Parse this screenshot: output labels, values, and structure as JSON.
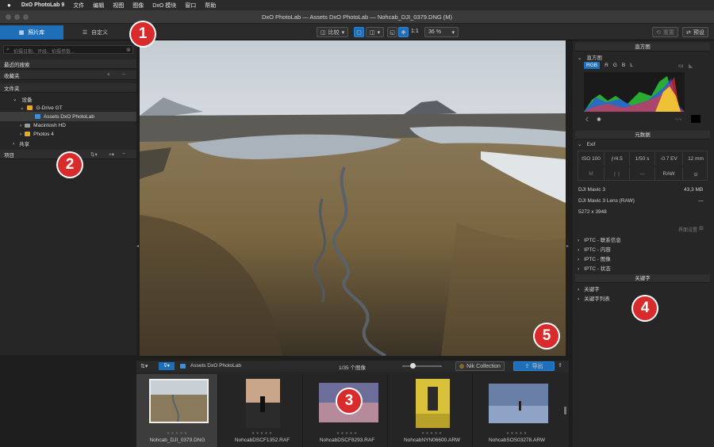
{
  "menubar": {
    "app": "DxO PhotoLab 9",
    "items": [
      "文件",
      "编辑",
      "视图",
      "图像",
      "DxO 模块",
      "窗口",
      "帮助"
    ]
  },
  "window": {
    "title": "DxO PhotoLab — Assets DxO PhotoLab — Nohcab_DJI_0379.DNG (M)"
  },
  "tabs": {
    "library": "照片库",
    "customize": "自定义"
  },
  "toolbar": {
    "compare": "比较",
    "one_to_one": "1:1",
    "zoom": "36 %",
    "reset": "重置",
    "preset": "预设"
  },
  "sidebar": {
    "search_placeholder": "拍摄日期、评级、拍摄参数...",
    "recent_searches": "最近的搜索",
    "favorites": "收藏夹",
    "folders": "文件夹",
    "devices": "设备",
    "gdrive": "G-Drive GT",
    "assets": "Assets DxO PhotoLab",
    "macintosh": "Macintosh HD",
    "photos": "Photos 4",
    "shared": "共享",
    "projects": "项目"
  },
  "histogram": {
    "section": "直方图",
    "title": "直方图",
    "channels": [
      "RGB",
      "R",
      "G",
      "B",
      "L"
    ]
  },
  "metadata": {
    "section": "元数据",
    "exif_label": "Exif",
    "iso": "ISO 100",
    "aperture": "ƒ/4.5",
    "shutter": "1/50 s",
    "ev": "-0.7 EV",
    "focal": "12 mm",
    "mode": "M",
    "dash": "—",
    "raw": "RAW",
    "camera": "DJI Mavic 3",
    "size": "43,3 MB",
    "lens": "DJI Mavic 3 Lens (RAW)",
    "lens_value": "—",
    "dimensions": "5272 x 3948",
    "settings": "界面设置",
    "iptc": [
      "IPTC - 联系信息",
      "IPTC - 内容",
      "IPTC - 图像",
      "IPTC - 状态"
    ]
  },
  "keywords": {
    "section": "关键字",
    "items": [
      "关键字",
      "关键字列表"
    ]
  },
  "filmbar": {
    "folder": "Assets DxO PhotoLab",
    "count": "1/35 个图像",
    "nik": "Nik Collection",
    "export": "导出"
  },
  "thumbnails": [
    {
      "name": "Nohcab_DJI_0379.DNG"
    },
    {
      "name": "NohcabDSCF1352.RAF"
    },
    {
      "name": "NohcabDSCF8293.RAF"
    },
    {
      "name": "NohcabNYN06600.ARW"
    },
    {
      "name": "NohcabSOS03278.ARW"
    }
  ],
  "badges": [
    "1",
    "2",
    "3",
    "4",
    "5"
  ],
  "colors": {
    "accent": "#1f6fb8",
    "badge": "#d92b2b",
    "folder": "#e6a92a"
  }
}
